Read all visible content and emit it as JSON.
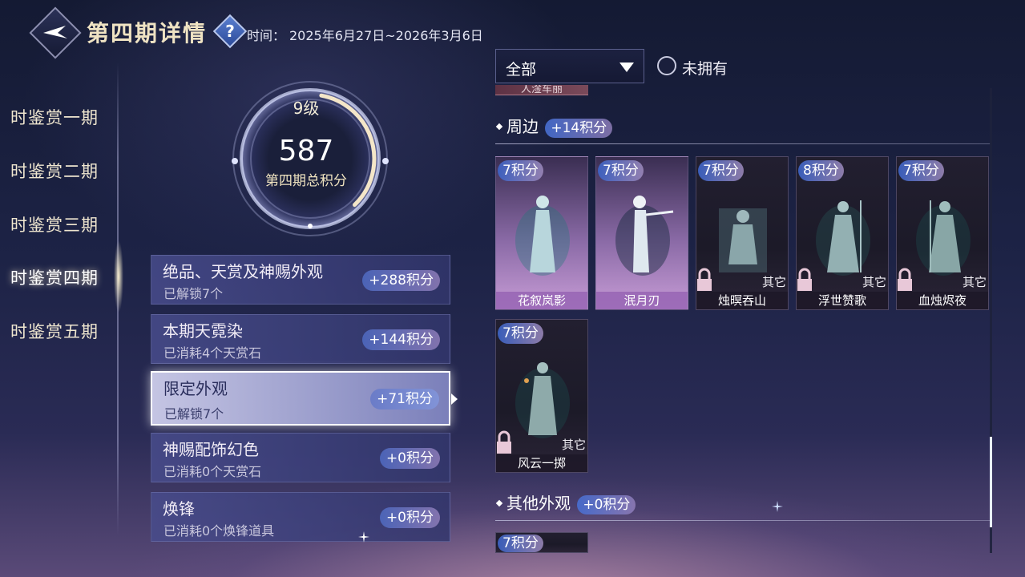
{
  "header": {
    "title": "第四期详情",
    "help_icon": "question-mark",
    "period_label": "时间：",
    "period_value": "2025年6月27日~2026年3月6日"
  },
  "nav": {
    "items": [
      {
        "label": "时鉴赏一期"
      },
      {
        "label": "时鉴赏二期"
      },
      {
        "label": "时鉴赏三期"
      },
      {
        "label": "时鉴赏四期",
        "active": true
      },
      {
        "label": "时鉴赏五期"
      }
    ]
  },
  "score": {
    "level": "9级",
    "value": "587",
    "label": "第四期总积分",
    "ring_progress": 0.35
  },
  "categories": [
    {
      "title": "绝品、天赏及神赐外观",
      "sub": "已解锁7个",
      "points": "+288积分"
    },
    {
      "title": "本期天霓染",
      "sub": "已消耗4个天赏石",
      "points": "+144积分"
    },
    {
      "title": "限定外观",
      "sub": "已解锁7个",
      "points": "+71积分",
      "active": true
    },
    {
      "title": "神赐配饰幻色",
      "sub": "已消耗0个天赏石",
      "points": "+0积分"
    },
    {
      "title": "焕锋",
      "sub": "已消耗0个焕锋道具",
      "points": "+0积分"
    }
  ],
  "filter": {
    "selected": "全部",
    "checkbox_label": "未拥有",
    "checked": false
  },
  "list": {
    "partial_top_label": "人淦车丽",
    "sections": [
      {
        "name": "周边",
        "points": "+14积分"
      },
      {
        "name": "其他外观",
        "points": "+0积分"
      }
    ],
    "items": [
      {
        "points": "7积分",
        "name": "花叙岚影",
        "owned": true,
        "tag": ""
      },
      {
        "points": "7积分",
        "name": "泯月刃",
        "owned": true,
        "tag": ""
      },
      {
        "points": "7积分",
        "name": "烛暝吞山",
        "owned": false,
        "tag": "其它"
      },
      {
        "points": "8积分",
        "name": "浮世赞歌",
        "owned": false,
        "tag": "其它"
      },
      {
        "points": "7积分",
        "name": "血烛烬夜",
        "owned": false,
        "tag": "其它"
      },
      {
        "points": "7积分",
        "name": "风云一掷",
        "owned": false,
        "tag": "其它"
      }
    ],
    "partial_bottom_points": "7积分"
  },
  "colors": {
    "accent_gold": "#efe3c3",
    "owned_card": "#c79cd6",
    "points_badge": "#466ed2"
  }
}
